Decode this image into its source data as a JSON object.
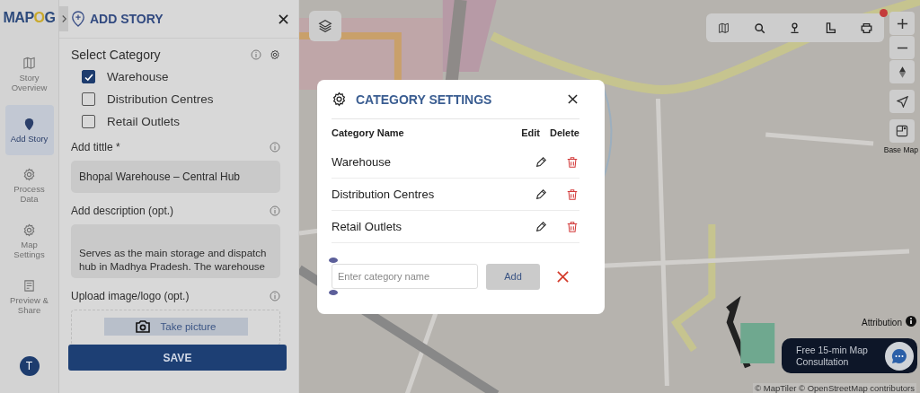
{
  "logo": [
    {
      "text": "MAP",
      "kind": "plain"
    },
    {
      "text": "O",
      "kind": "accent"
    },
    {
      "text": "G",
      "kind": "plain"
    }
  ],
  "nav": [
    {
      "label": "Story Overview",
      "selected": false
    },
    {
      "label": "Add Story",
      "selected": true
    },
    {
      "label": "Process Data",
      "selected": false
    },
    {
      "label": "Map Settings",
      "selected": false
    },
    {
      "label": "Preview & Share",
      "selected": false
    }
  ],
  "avatar": "T",
  "panel": {
    "title": "ADD STORY",
    "category_label": "Select Category",
    "categories": [
      {
        "label": "Warehouse",
        "checked": true
      },
      {
        "label": "Distribution Centres",
        "checked": false
      },
      {
        "label": "Retail Outlets",
        "checked": false
      }
    ],
    "title_label": "Add tittle *",
    "title_value": "Bhopal Warehouse – Central Hub",
    "description_label": "Add description (opt.)",
    "description_value": "Serves as the main storage and dispatch hub in Madhya Pradesh. The warehouse",
    "upload_label": "Upload image/logo (opt.)",
    "upload_button": "Take picture",
    "save": "SAVE"
  },
  "modal": {
    "title": "CATEGORY SETTINGS",
    "columns": [
      "Category Name",
      "Edit",
      "Delete"
    ],
    "rows": [
      {
        "name": "Warehouse"
      },
      {
        "name": "Distribution Centres"
      },
      {
        "name": "Retail Outlets"
      }
    ],
    "placeholder": "Enter category name",
    "add": "Add"
  },
  "map": {
    "base_map": "Base Map",
    "attribution": "Attribution",
    "consultation": "Free 15-min Map Consultation",
    "copyright": "© MapTiler © OpenStreetMap contributors"
  }
}
